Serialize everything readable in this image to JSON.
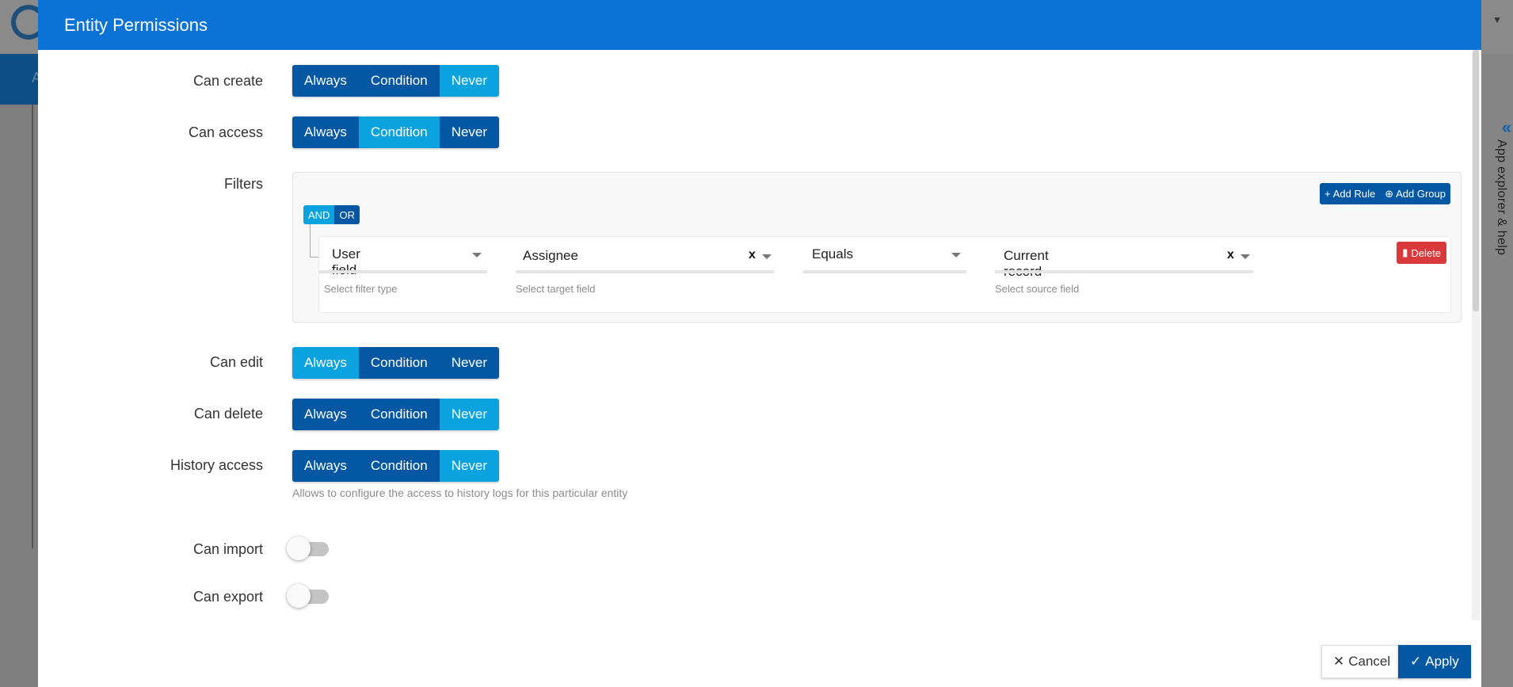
{
  "modal": {
    "title": "Entity Permissions"
  },
  "background": {
    "nav_letter": "A",
    "explorer_label": "App explorer & help"
  },
  "segment_options": [
    "Always",
    "Condition",
    "Never"
  ],
  "rows": {
    "can_create": {
      "label": "Can create",
      "selected": "Never"
    },
    "can_access": {
      "label": "Can access",
      "selected": "Condition"
    },
    "can_edit": {
      "label": "Can edit",
      "selected": "Always"
    },
    "can_delete": {
      "label": "Can delete",
      "selected": "Never"
    },
    "history_access": {
      "label": "History access",
      "selected": "Never",
      "hint": "Allows to configure the access to history logs for this particular entity"
    },
    "can_import": {
      "label": "Can import",
      "enabled": false
    },
    "can_export": {
      "label": "Can export",
      "enabled": false
    }
  },
  "filters": {
    "label": "Filters",
    "and_label": "AND",
    "or_label": "OR",
    "active_operator": "AND",
    "add_rule": "Add Rule",
    "add_group": "Add Group",
    "rule": {
      "filter_type": {
        "value": "User field",
        "hint": "Select filter type"
      },
      "target_field": {
        "value": "Assignee",
        "hint": "Select target field"
      },
      "operator": {
        "value": "Equals"
      },
      "source_field": {
        "value": "Current record",
        "hint": "Select source field"
      },
      "clear_symbol": "x",
      "delete_label": "Delete"
    }
  },
  "footer": {
    "cancel_label": "Cancel",
    "apply_label": "Apply"
  },
  "colors": {
    "header": "#0b73d5",
    "segment": "#0457a2",
    "segment_active": "#0aa3df",
    "delete": "#d9393a"
  }
}
